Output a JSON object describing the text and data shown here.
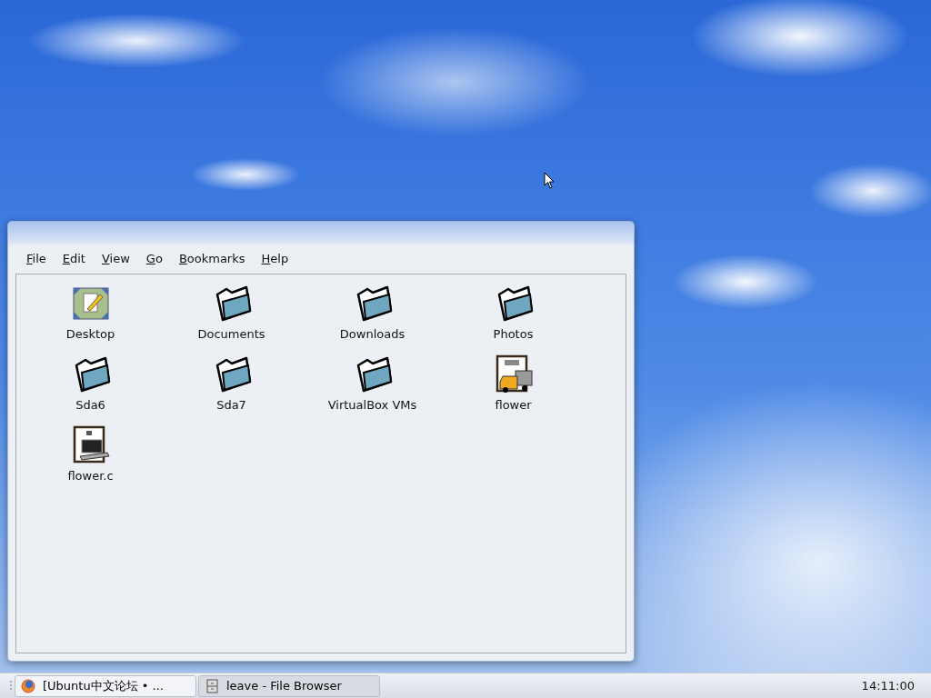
{
  "window": {
    "menu": [
      "File",
      "Edit",
      "View",
      "Go",
      "Bookmarks",
      "Help"
    ],
    "files": [
      {
        "name": "Desktop",
        "kind": "desktop"
      },
      {
        "name": "Documents",
        "kind": "folder"
      },
      {
        "name": "Downloads",
        "kind": "folder"
      },
      {
        "name": "Photos",
        "kind": "folder"
      },
      {
        "name": "Sda6",
        "kind": "folder"
      },
      {
        "name": "Sda7",
        "kind": "folder"
      },
      {
        "name": "VirtualBox VMs",
        "kind": "folder"
      },
      {
        "name": "flower",
        "kind": "binary"
      },
      {
        "name": "flower.c",
        "kind": "source"
      }
    ]
  },
  "taskbar": {
    "tasks": [
      {
        "label": "[Ubuntu中文论坛 • ...",
        "kind": "browser",
        "selected": false
      },
      {
        "label": "leave - File Browser",
        "kind": "files",
        "selected": true
      }
    ],
    "clock": "14:11:00"
  }
}
